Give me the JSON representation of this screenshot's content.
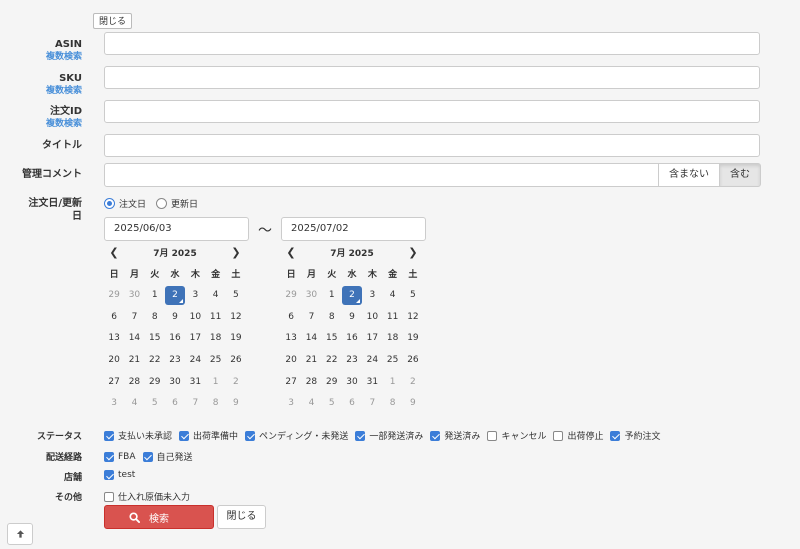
{
  "top_close_label": "閉じる",
  "fields": {
    "asin": {
      "label": "ASIN",
      "sub": "複数検索",
      "value": ""
    },
    "sku": {
      "label": "SKU",
      "sub": "複数検索",
      "value": ""
    },
    "order_id": {
      "label": "注文ID",
      "sub": "複数検索",
      "value": ""
    },
    "title": {
      "label": "タイトル",
      "value": ""
    },
    "comment": {
      "label": "管理コメント",
      "value": "",
      "exclude_label": "含まない",
      "include_label": "含む"
    }
  },
  "date": {
    "label_line1": "注文日/更新",
    "label_line2": "日",
    "options": [
      {
        "label": "注文日",
        "selected": true
      },
      {
        "label": "更新日",
        "selected": false
      }
    ],
    "from": "2025/06/03",
    "to": "2025/07/02",
    "tilde": "〜"
  },
  "calendar": {
    "month_label": "7月 2025",
    "weekdays": [
      "日",
      "月",
      "火",
      "水",
      "木",
      "金",
      "土"
    ],
    "weeks": [
      [
        "29",
        "30",
        "1",
        "2",
        "3",
        "4",
        "5"
      ],
      [
        "6",
        "7",
        "8",
        "9",
        "10",
        "11",
        "12"
      ],
      [
        "13",
        "14",
        "15",
        "16",
        "17",
        "18",
        "19"
      ],
      [
        "20",
        "21",
        "22",
        "23",
        "24",
        "25",
        "26"
      ],
      [
        "27",
        "28",
        "29",
        "30",
        "31",
        "1",
        "2"
      ],
      [
        "3",
        "4",
        "5",
        "6",
        "7",
        "8",
        "9"
      ]
    ],
    "selected_day": "2"
  },
  "status": {
    "label": "ステータス",
    "options": [
      {
        "label": "支払い未承認",
        "checked": true
      },
      {
        "label": "出荷準備中",
        "checked": true
      },
      {
        "label": "ペンディング・未発送",
        "checked": true
      },
      {
        "label": "一部発送済み",
        "checked": true
      },
      {
        "label": "発送済み",
        "checked": true
      },
      {
        "label": "キャンセル",
        "checked": false
      },
      {
        "label": "出荷停止",
        "checked": false
      },
      {
        "label": "予約注文",
        "checked": true
      }
    ]
  },
  "route": {
    "label": "配送経路",
    "options": [
      {
        "label": "FBA",
        "checked": true
      },
      {
        "label": "自己発送",
        "checked": true
      }
    ]
  },
  "shop": {
    "label": "店舗",
    "options": [
      {
        "label": "test",
        "checked": true
      }
    ]
  },
  "other": {
    "label": "その他",
    "options": [
      {
        "label": "仕入れ原価未入力",
        "checked": false
      }
    ]
  },
  "actions": {
    "search_label": "検索",
    "close_label": "閉じる"
  },
  "colors": {
    "accent": "#3b7dd8",
    "search_button": "#d9534f",
    "link": "#4a90d9"
  }
}
